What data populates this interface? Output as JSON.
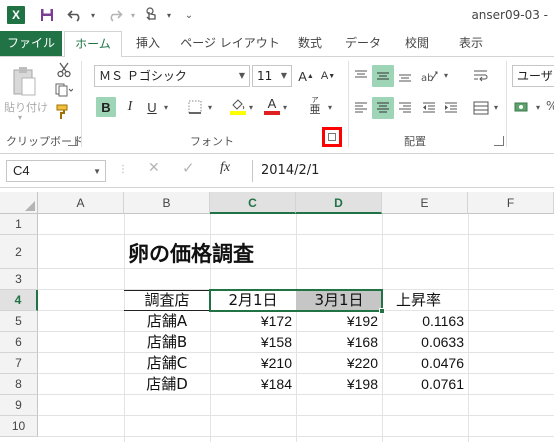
{
  "title_bar": {
    "app_icon": "X",
    "window_title": "anser09-03 -",
    "qa_icons": [
      "save-icon",
      "undo-icon",
      "redo-icon",
      "touch-mode-icon",
      "customize-icon"
    ]
  },
  "tabs": [
    "ファイル",
    "ホーム",
    "挿入",
    "ページ レイアウト",
    "数式",
    "データ",
    "校閲",
    "表示"
  ],
  "ribbon": {
    "clipboard": {
      "paste_label": "貼り付け",
      "group_label": "クリップボード"
    },
    "font": {
      "font_name": "ＭＳ Ｐゴシック",
      "font_size": "11",
      "bold": "B",
      "italic": "I",
      "underline": "U",
      "grow_font": "A",
      "shrink_font": "A",
      "font_color": "A",
      "phonetic": "亜",
      "group_label": "フォント"
    },
    "alignment": {
      "group_label": "配置"
    },
    "number": {
      "format_value": "ユーザー"
    },
    "colors": {
      "accent": "#217346",
      "highlight": "#ff0000",
      "font_color_bar": "#e02020",
      "fill_color_bar": "#ffff00"
    }
  },
  "formula_bar": {
    "name_box": "C4",
    "fx": "fx",
    "value": "2014/2/1"
  },
  "sheet": {
    "columns": [
      "A",
      "B",
      "C",
      "D",
      "E",
      "F"
    ],
    "rows": [
      "1",
      "2",
      "3",
      "4",
      "5",
      "6",
      "7",
      "8",
      "9",
      "10"
    ],
    "title": "卵の価格調査",
    "header": [
      "調査店",
      "2月1日",
      "3月1日",
      "上昇率"
    ],
    "data": [
      [
        "店舗A",
        "¥172",
        "¥192",
        "0.1163"
      ],
      [
        "店舗B",
        "¥158",
        "¥168",
        "0.0633"
      ],
      [
        "店舗C",
        "¥210",
        "¥220",
        "0.0476"
      ],
      [
        "店舗D",
        "¥184",
        "¥198",
        "0.0761"
      ]
    ]
  }
}
